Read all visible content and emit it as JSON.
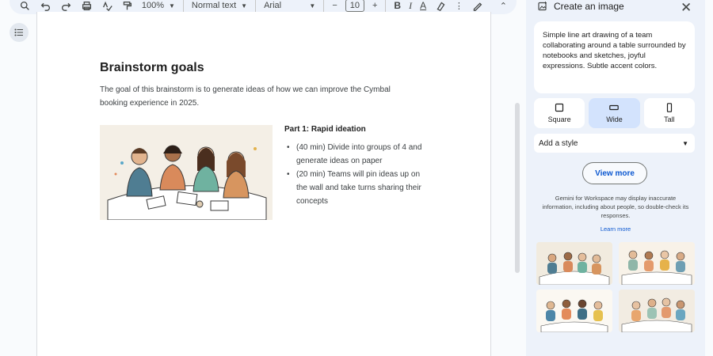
{
  "toolbar": {
    "zoom": "100%",
    "text_style": "Normal text",
    "font": "Arial",
    "font_size": "10",
    "bold": "B",
    "italic": "I",
    "text_color": "A"
  },
  "document": {
    "title": "Brainstorm goals",
    "paragraph": "The goal of this brainstorm is to generate ideas of how we can improve the Cymbal booking experience in 2025.",
    "part_title": "Part 1: Rapid ideation",
    "bullets": [
      "(40 min) Divide into groups of 4 and generate ideas on paper",
      "(20 min) Teams will pin ideas up on the wall and take turns sharing their concepts"
    ]
  },
  "panel": {
    "title": "Create an image",
    "close_icon": "close-icon",
    "prompt": "Simple line art drawing of a team collaborating around a table surrounded by notebooks and sketches, joyful expressions. Subtle accent colors.",
    "shapes": [
      {
        "label": "Square",
        "selected": false
      },
      {
        "label": "Wide",
        "selected": true
      },
      {
        "label": "Tall",
        "selected": false
      }
    ],
    "style_placeholder": "Add a style",
    "view_more": "View more",
    "disclaimer": "Gemini for Workspace may display inaccurate information, including about people, so double-check its responses.",
    "learn_more": "Learn more"
  },
  "colors": {
    "accent": "#0b57d0",
    "selected_chip": "#d3e3fd",
    "panel_bg": "#edf2fa"
  }
}
